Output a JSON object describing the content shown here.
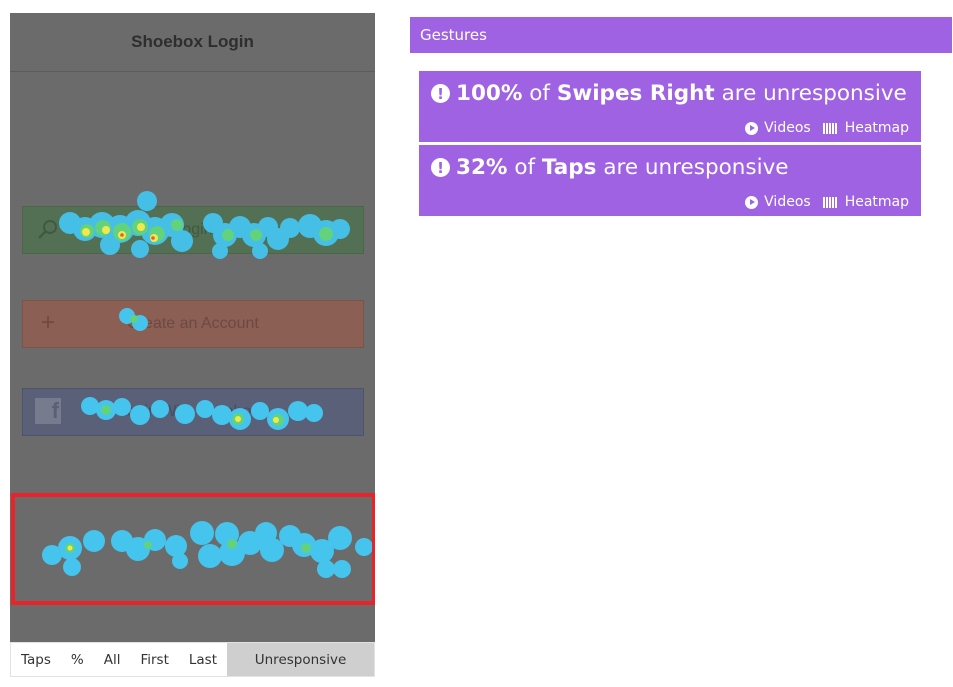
{
  "phone": {
    "title": "Shoebox Login",
    "buttons": {
      "login": "Login",
      "create": "Create an Account",
      "facebook": "Login With Facebook"
    },
    "icons": {
      "plus": "+",
      "facebook": "f"
    }
  },
  "tabs": [
    {
      "label": "Taps",
      "active": false
    },
    {
      "label": "%",
      "active": false
    },
    {
      "label": "All",
      "active": false
    },
    {
      "label": "First",
      "active": false
    },
    {
      "label": "Last",
      "active": false
    },
    {
      "label": "Unresponsive",
      "active": true
    }
  ],
  "gestures": {
    "header": "Gestures",
    "items": [
      {
        "percent": "100%",
        "of": "of",
        "gesture": "Swipes Right",
        "suffix": "are unresponsive",
        "videos_label": "Videos",
        "heatmap_label": "Heatmap"
      },
      {
        "percent": "32%",
        "of": "of",
        "gesture": "Taps",
        "suffix": "are unresponsive",
        "videos_label": "Videos",
        "heatmap_label": "Heatmap"
      }
    ]
  },
  "colors": {
    "accent": "#9f62e2",
    "highlight": "#e8232a",
    "overlay": "#6b6b6b"
  }
}
